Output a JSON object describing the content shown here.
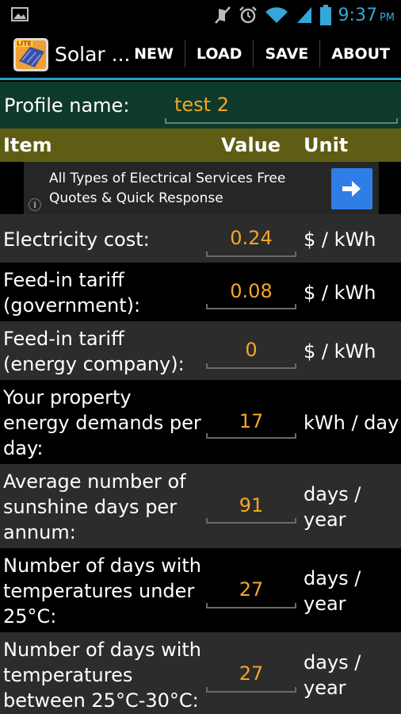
{
  "status_bar": {
    "time": "9:37",
    "ampm": "PM",
    "icons": [
      "image-icon",
      "mute-icon",
      "alarm-icon",
      "wifi-icon",
      "signal-icon",
      "battery-icon"
    ]
  },
  "action_bar": {
    "title": "Solar ...",
    "app_icon_badge": "LITE",
    "menu": [
      "NEW",
      "LOAD",
      "SAVE",
      "ABOUT"
    ]
  },
  "profile": {
    "label": "Profile name:",
    "value": "test 2"
  },
  "table_header": {
    "item": "Item",
    "value": "Value",
    "unit": "Unit"
  },
  "ad": {
    "text": "All Types of Electrical Services Free Quotes & Quick Response",
    "info": "i"
  },
  "rows": [
    {
      "item": "Electricity cost:",
      "value": "0.24",
      "unit": "$ / kWh"
    },
    {
      "item": "Feed-in tariff (government):",
      "value": "0.08",
      "unit": "$ / kWh"
    },
    {
      "item": "Feed-in tariff (energy company):",
      "value": "0",
      "unit": "$ / kWh"
    },
    {
      "item": "Your property energy demands per day:",
      "value": "17",
      "unit": "kWh / day"
    },
    {
      "item": "Average number of sunshine days per annum:",
      "value": "91",
      "unit": "days / year"
    },
    {
      "item": "Number of days with temperatures under 25°C:",
      "value": "27",
      "unit": "days / year"
    },
    {
      "item": "Number of days with temperatures between 25°C-30°C:",
      "value": "27",
      "unit": "days / year"
    }
  ],
  "colors": {
    "accent_blue": "#2a9ed0",
    "value_orange": "#f5a623",
    "profile_bg": "#0e3a2c",
    "header_bg": "#5f5c14",
    "ad_button": "#2f7de6"
  }
}
